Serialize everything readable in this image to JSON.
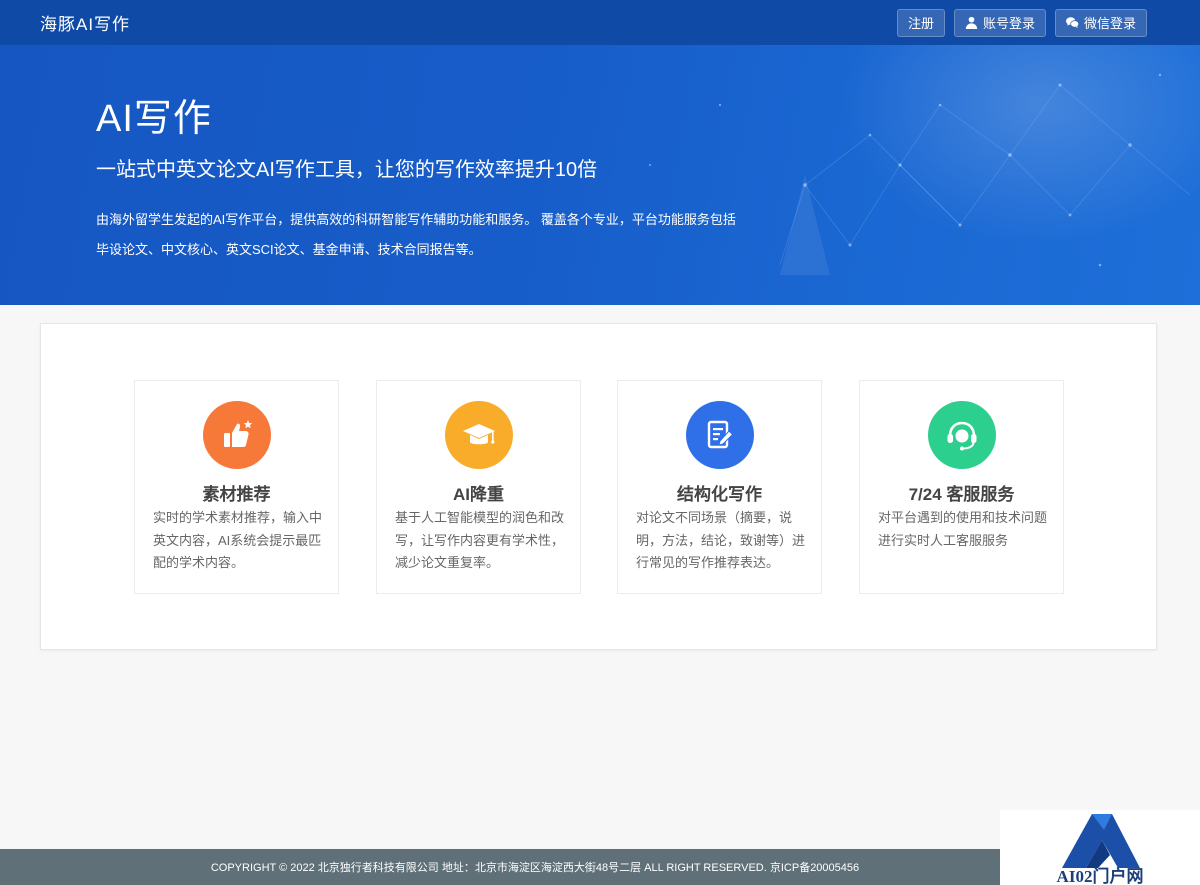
{
  "header": {
    "brand": "海豚AI写作",
    "register_label": "注册",
    "account_login_label": "账号登录",
    "wechat_login_label": "微信登录"
  },
  "hero": {
    "title": "AI写作",
    "subtitle": "一站式中英文论文AI写作工具，让您的写作效率提升10倍",
    "description_line1": "由海外留学生发起的AI写作平台，提供高效的科研智能写作辅助功能和服务。 覆盖各个专业，平台功能服务包括",
    "description_line2": "毕设论文、中文核心、英文SCI论文、基金申请、技术合同报告等。"
  },
  "features": [
    {
      "title": "素材推荐",
      "description": "实时的学术素材推荐，输入中英文内容，AI系统会提示最匹配的学术内容。",
      "icon": "thumbs-up-star-icon",
      "color": "#f7793a"
    },
    {
      "title": "AI降重",
      "description": "基于人工智能模型的润色和改写，让写作内容更有学术性，减少论文重复率。",
      "icon": "graduation-cap-icon",
      "color": "#f9ac2a"
    },
    {
      "title": "结构化写作",
      "description": "对论文不同场景（摘要，说明，方法，结论，致谢等）进行常见的写作推荐表达。",
      "icon": "document-edit-icon",
      "color": "#2f6fe8"
    },
    {
      "title": "7/24 客服服务",
      "description": "对平台遇到的使用和技术问题进行实时人工客服服务",
      "icon": "headset-icon",
      "color": "#2ccf8e"
    }
  ],
  "footer": {
    "copyright": "COPYRIGHT © 2022 北京独行者科技有限公司 地址：北京市海淀区海淀西大街48号二层 ALL RIGHT RESERVED. 京ICP备20005456"
  },
  "watermark": {
    "text": "AI02门户网"
  }
}
